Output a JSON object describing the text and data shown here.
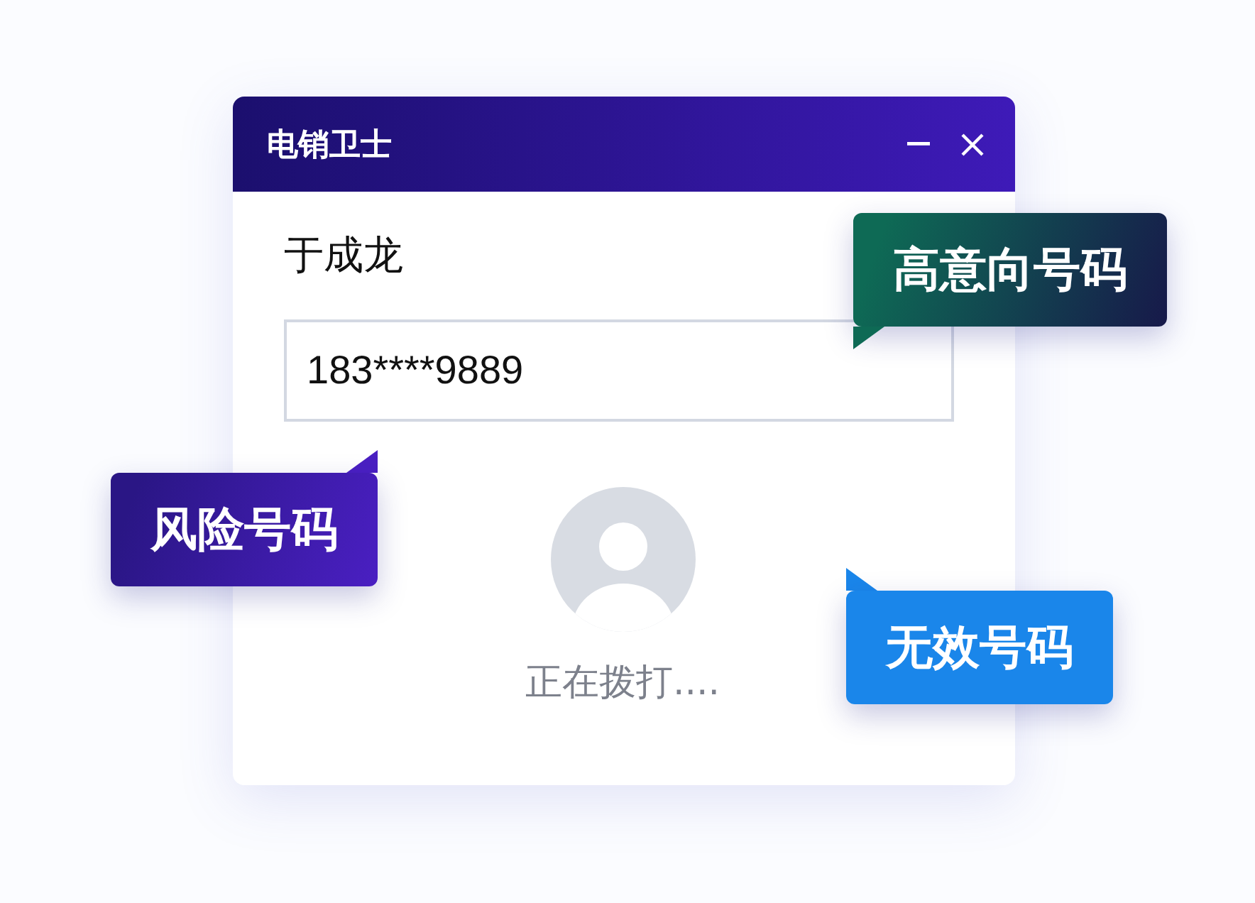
{
  "window": {
    "title": "电销卫士"
  },
  "contact": {
    "name": "于成龙",
    "phone": "183****9889",
    "status": "正在拨打...."
  },
  "tags": [
    {
      "label": "高意向号码",
      "color": "#0e6a55"
    },
    {
      "label": "风险号码",
      "color": "#2a1685"
    },
    {
      "label": "无效号码",
      "color": "#1a86ea"
    }
  ]
}
